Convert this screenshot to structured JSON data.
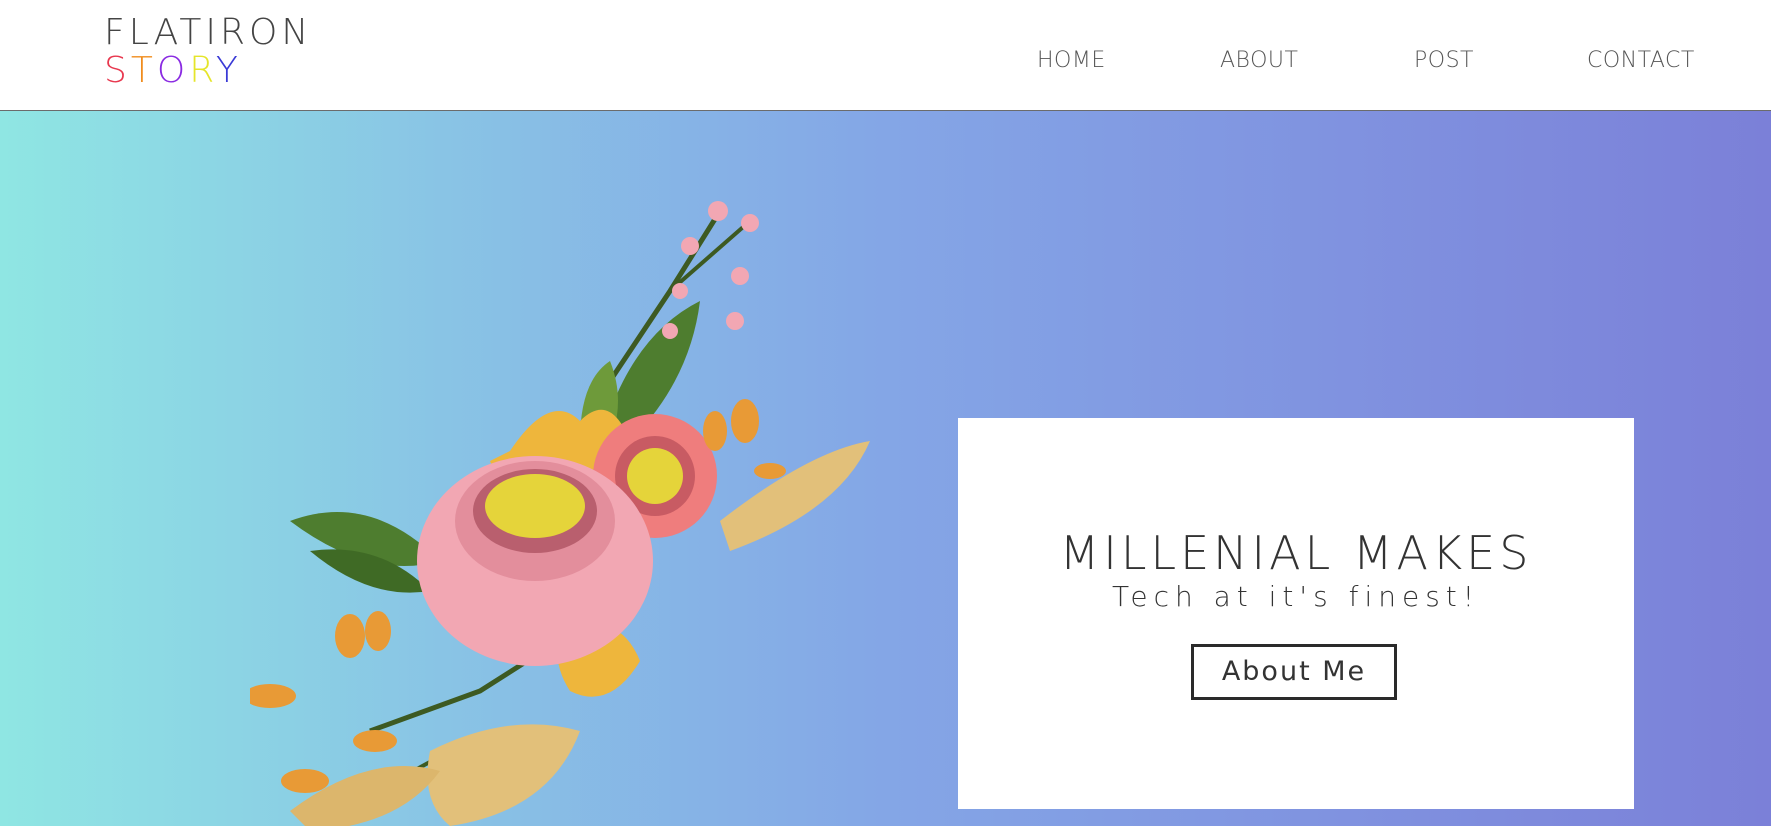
{
  "logo": {
    "line1": "FLATIRON",
    "line2_letters": [
      "S",
      "T",
      "O",
      "R",
      "Y"
    ],
    "line2_colors": [
      "#e8384f",
      "#f08c1d",
      "#8a2be2",
      "#e5e52a",
      "#3a3ad6"
    ]
  },
  "nav": {
    "home": "HOME",
    "about": "ABOUT",
    "post": "POST",
    "contact": "CONTACT"
  },
  "hero": {
    "title": "MILLENIAL MAKES",
    "subtitle": "Tech at it's finest!",
    "button": "About Me",
    "gradient": [
      "#8fe6e3",
      "#7b80d8"
    ]
  },
  "colors": {
    "petal_pink": "#f2a7b3",
    "coral": "#ef7d7d",
    "leaf_green": "#4e7d2f",
    "gold": "#eeb63c",
    "tan": "#e2c07a"
  }
}
